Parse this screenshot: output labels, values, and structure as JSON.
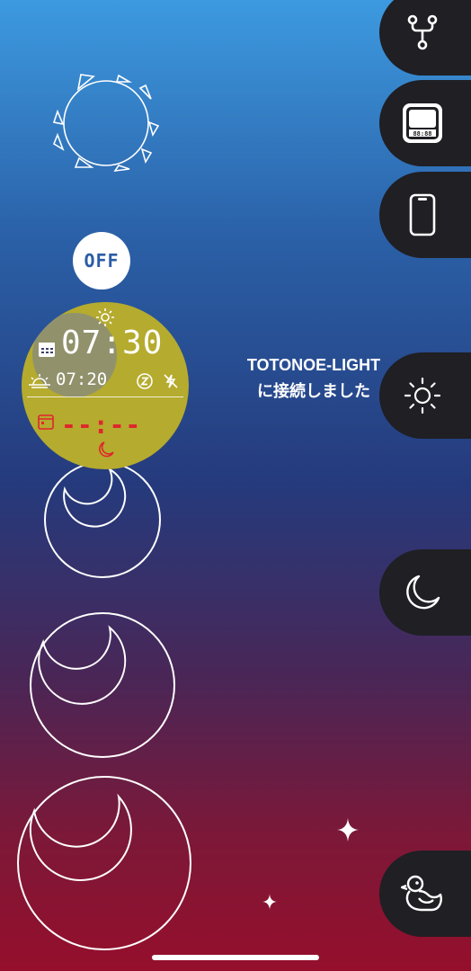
{
  "power": {
    "label": "OFF"
  },
  "clock": {
    "main_time": "07:30",
    "sub_time": "07:20",
    "night_time": "--:--"
  },
  "status": {
    "message": "TOTONOE-LIGHTに接続しました"
  },
  "sidebar": {
    "items": [
      {
        "icon": "branch-icon"
      },
      {
        "icon": "clock-device-icon",
        "display": "88:88"
      },
      {
        "icon": "smartphone-icon"
      },
      {
        "icon": "sun-icon"
      },
      {
        "icon": "moon-icon"
      },
      {
        "icon": "duck-icon"
      }
    ]
  },
  "colors": {
    "clock_face": "#b5ab2e",
    "tab_background": "#1f1f24",
    "alarm_red": "#e0252e",
    "off_text": "#2b5ca6"
  }
}
